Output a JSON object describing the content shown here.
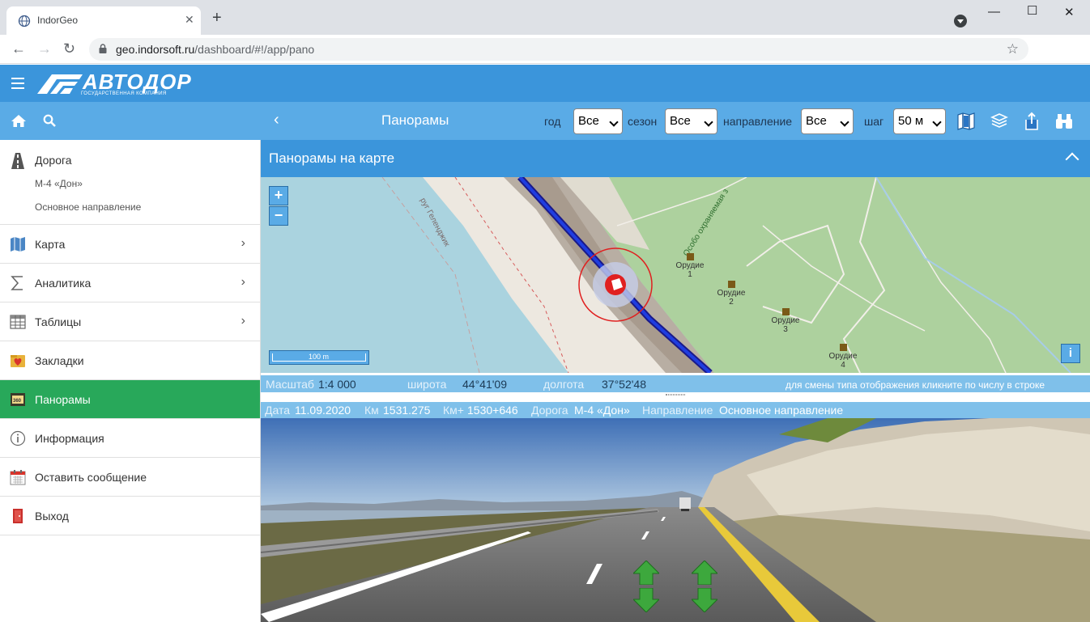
{
  "browser": {
    "tab_title": "IndorGeo",
    "url_host": "geo.indorsoft.ru",
    "url_path": "/dashboard/#!/app/pano"
  },
  "app": {
    "logo_text": "АВТОДОР",
    "logo_subtext": "ГОСУДАРСТВЕННАЯ КОМПАНИЯ",
    "page_title": "Панорамы"
  },
  "filters": {
    "year_label": "год",
    "year_value": "Все",
    "season_label": "сезон",
    "season_value": "Все",
    "direction_label": "направление",
    "direction_value": "Все",
    "step_label": "шаг",
    "step_value": "50 м"
  },
  "sidebar": {
    "road": {
      "title": "Дорога",
      "name": "М-4 «Дон»",
      "direction": "Основное направление"
    },
    "items": [
      {
        "label": "Карта",
        "icon": "map-icon",
        "chevron": true,
        "active": false
      },
      {
        "label": "Аналитика",
        "icon": "sigma-icon",
        "chevron": true,
        "active": false
      },
      {
        "label": "Таблицы",
        "icon": "table-icon",
        "chevron": true,
        "active": false
      },
      {
        "label": "Закладки",
        "icon": "bookmark-heart-icon",
        "chevron": false,
        "active": false
      },
      {
        "label": "Панорамы",
        "icon": "panorama-360-icon",
        "chevron": false,
        "active": true
      },
      {
        "label": "Информация",
        "icon": "info-icon",
        "chevron": false,
        "active": false
      },
      {
        "label": "Оставить сообщение",
        "icon": "calendar-icon",
        "chevron": false,
        "active": false
      },
      {
        "label": "Выход",
        "icon": "exit-door-icon",
        "chevron": false,
        "active": false
      }
    ]
  },
  "map_panel": {
    "title": "Панорамы на карте",
    "zoom_in": "+",
    "zoom_out": "−",
    "scale_bar": "100 m",
    "info_button": "i",
    "road_label": "Особо охраняемая з",
    "district_label": "руг Геленджик",
    "pois": [
      "Орудие 1",
      "Орудие 2",
      "Орудие 3",
      "Орудие 4"
    ],
    "poi_names": [
      "Орудие",
      "Орудие",
      "Орудие",
      "Орудие"
    ],
    "poi_numbers": [
      "1",
      "2",
      "3",
      "4"
    ]
  },
  "map_status": {
    "scale_label": "Масштаб",
    "scale_value": "1:4 000",
    "lat_label": "широта",
    "lat_value": "44°41'09",
    "lon_label": "долгота",
    "lon_value": "37°52'48",
    "hint": "для смены типа отображения кликните по числу в строке"
  },
  "pano_status": {
    "date_label": "Дата",
    "date_value": "11.09.2020",
    "km_label": "Км",
    "km_value": "1531.275",
    "kmplus_label": "Км+",
    "kmplus_value": "1530+646",
    "road_label": "Дорога",
    "road_value": "М-4 «Дон»",
    "dir_label": "Направление",
    "dir_value": "Основное направление"
  },
  "colors": {
    "header_blue": "#3b95db",
    "subheader_blue": "#5aabe6",
    "active_green": "#28a85a",
    "status_bar": "#7fc0ea"
  }
}
